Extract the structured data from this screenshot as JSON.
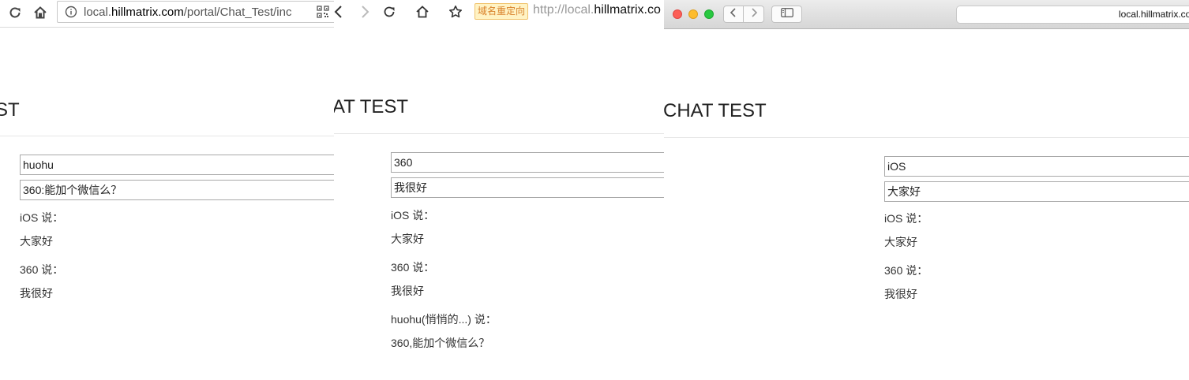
{
  "chrome": {
    "url_prefix": "local.",
    "url_domain": "hillmatrix.com",
    "url_path": "/portal/Chat_Test/inc",
    "page_title": "ST",
    "name_value": "huohu",
    "message_value": "360:能加个微信么？",
    "messages": [
      {
        "speaker": "iOS 说：",
        "text": "大家好"
      },
      {
        "speaker": "360 说：",
        "text": "我很好"
      }
    ]
  },
  "browser360": {
    "redirect_badge": "域名重定向",
    "url_prefix": "http://local.",
    "url_domain": "hillmatrix.co",
    "page_title": "AT TEST",
    "name_value": "360",
    "message_value": "我很好",
    "messages": [
      {
        "speaker": "iOS 说：",
        "text": "大家好"
      },
      {
        "speaker": "360 说：",
        "text": "我很好"
      },
      {
        "speaker": "huohu(悄悄的...) 说：",
        "text": "360,能加个微信么？"
      }
    ]
  },
  "safari": {
    "url_text": "local.hillmatrix.co",
    "page_title": "CHAT TEST",
    "name_value": "iOS",
    "message_value": "大家好",
    "messages": [
      {
        "speaker": "iOS 说：",
        "text": "大家好"
      },
      {
        "speaker": "360 说：",
        "text": "我很好"
      }
    ]
  },
  "colors": {
    "badge_bg": "#fff3c4",
    "badge_border": "#f0c36d",
    "badge_text": "#d9822b",
    "traffic_red": "#fc5f57",
    "traffic_yellow": "#fdbc2e",
    "traffic_green": "#28c840"
  },
  "icons": [
    "reload-icon",
    "home-icon",
    "info-icon",
    "qr-code-icon",
    "back-icon",
    "forward-icon",
    "star-icon",
    "sidebar-icon"
  ]
}
